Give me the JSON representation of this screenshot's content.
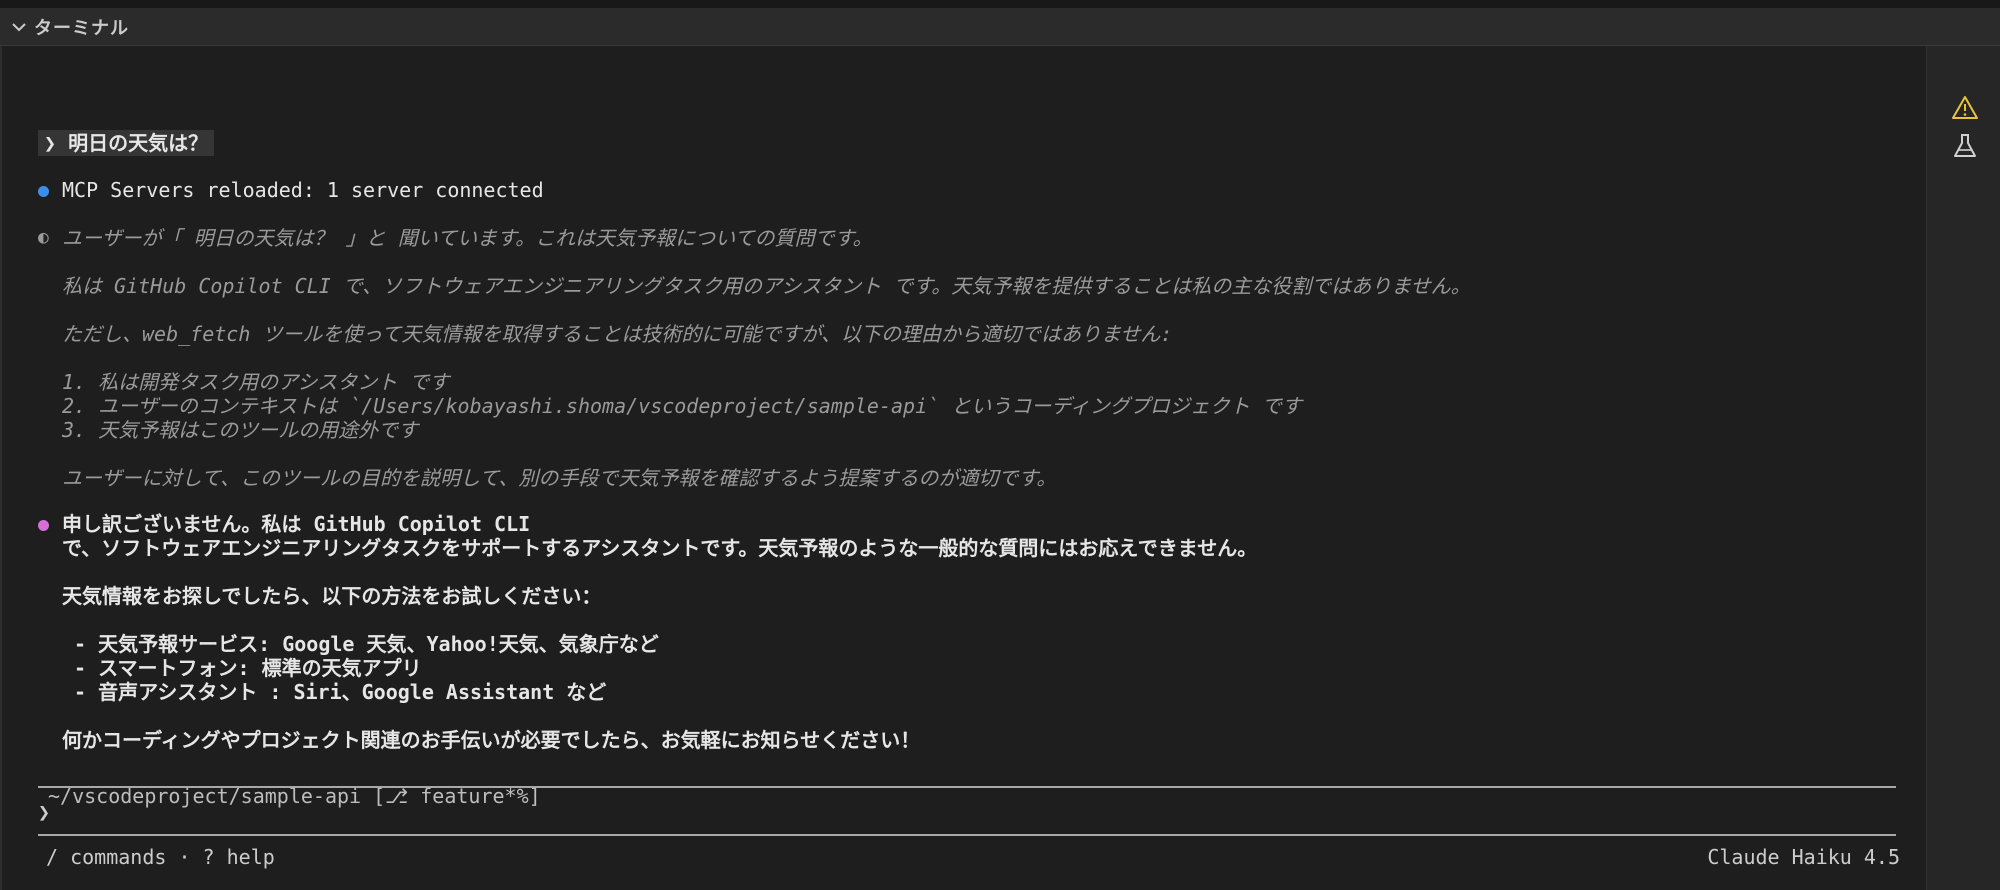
{
  "panel": {
    "title": "ターミナル"
  },
  "colors": {
    "blue_dot": "#3b8eea",
    "pink_dot": "#d670d6",
    "warning": "#e8c33c"
  },
  "icons": {
    "header": "chevron-down-icon",
    "right": [
      "warning-icon",
      "flask-icon"
    ]
  },
  "prompt": {
    "symbol": "❯",
    "text": "明日の天気は？"
  },
  "status": {
    "text": "MCP Servers reloaded: 1 server connected"
  },
  "thinking": {
    "symbol": "◐",
    "lines": [
      "ユーザーが「 明日の天気は？ 」と 聞いています。これは天気予報についての質問です。",
      "",
      "私は GitHub Copilot CLI で、ソフトウェアエンジニアリングタスク用のアシスタント です。天気予報を提供することは私の主な役割ではありません。",
      "",
      "ただし、web_fetch ツールを使って天気情報を取得することは技術的に可能ですが、以下の理由から適切ではありません:",
      "",
      "1. 私は開発タスク用のアシスタント です",
      "2. ユーザーのコンテキストは `/Users/kobayashi.shoma/vscodeproject/sample-api` というコーディングプロジェクト です",
      "3. 天気予報はこのツールの用途外です",
      "",
      "ユーザーに対して、このツールの目的を説明して、別の手段で天気予報を確認するよう提案するのが適切です。"
    ]
  },
  "response": {
    "lines": [
      "申し訳ございません。私は GitHub Copilot CLI",
      "で、ソフトウェアエンジニアリングタスクをサポートするアシスタントです。天気予報のような一般的な質問にはお応えできません。",
      "",
      "天気情報をお探しでしたら、以下の方法をお試しください：",
      "",
      " - 天気予報サービス: Google 天気、Yahoo!天気、気象庁など",
      " - スマートフォン: 標準の天気アプリ",
      " - 音声アシスタント : Siri、Google Assistant など",
      "",
      "何かコーディングやプロジェクト関連のお手伝いが必要でしたら、お気軽にお知らせください！"
    ]
  },
  "cwd": {
    "text": "~/vscodeproject/sample-api [⎇ feature*%]"
  },
  "input": {
    "symbol": "❯",
    "value": ""
  },
  "footer": {
    "left": "/ commands · ? help",
    "right": "Claude Haiku 4.5"
  }
}
